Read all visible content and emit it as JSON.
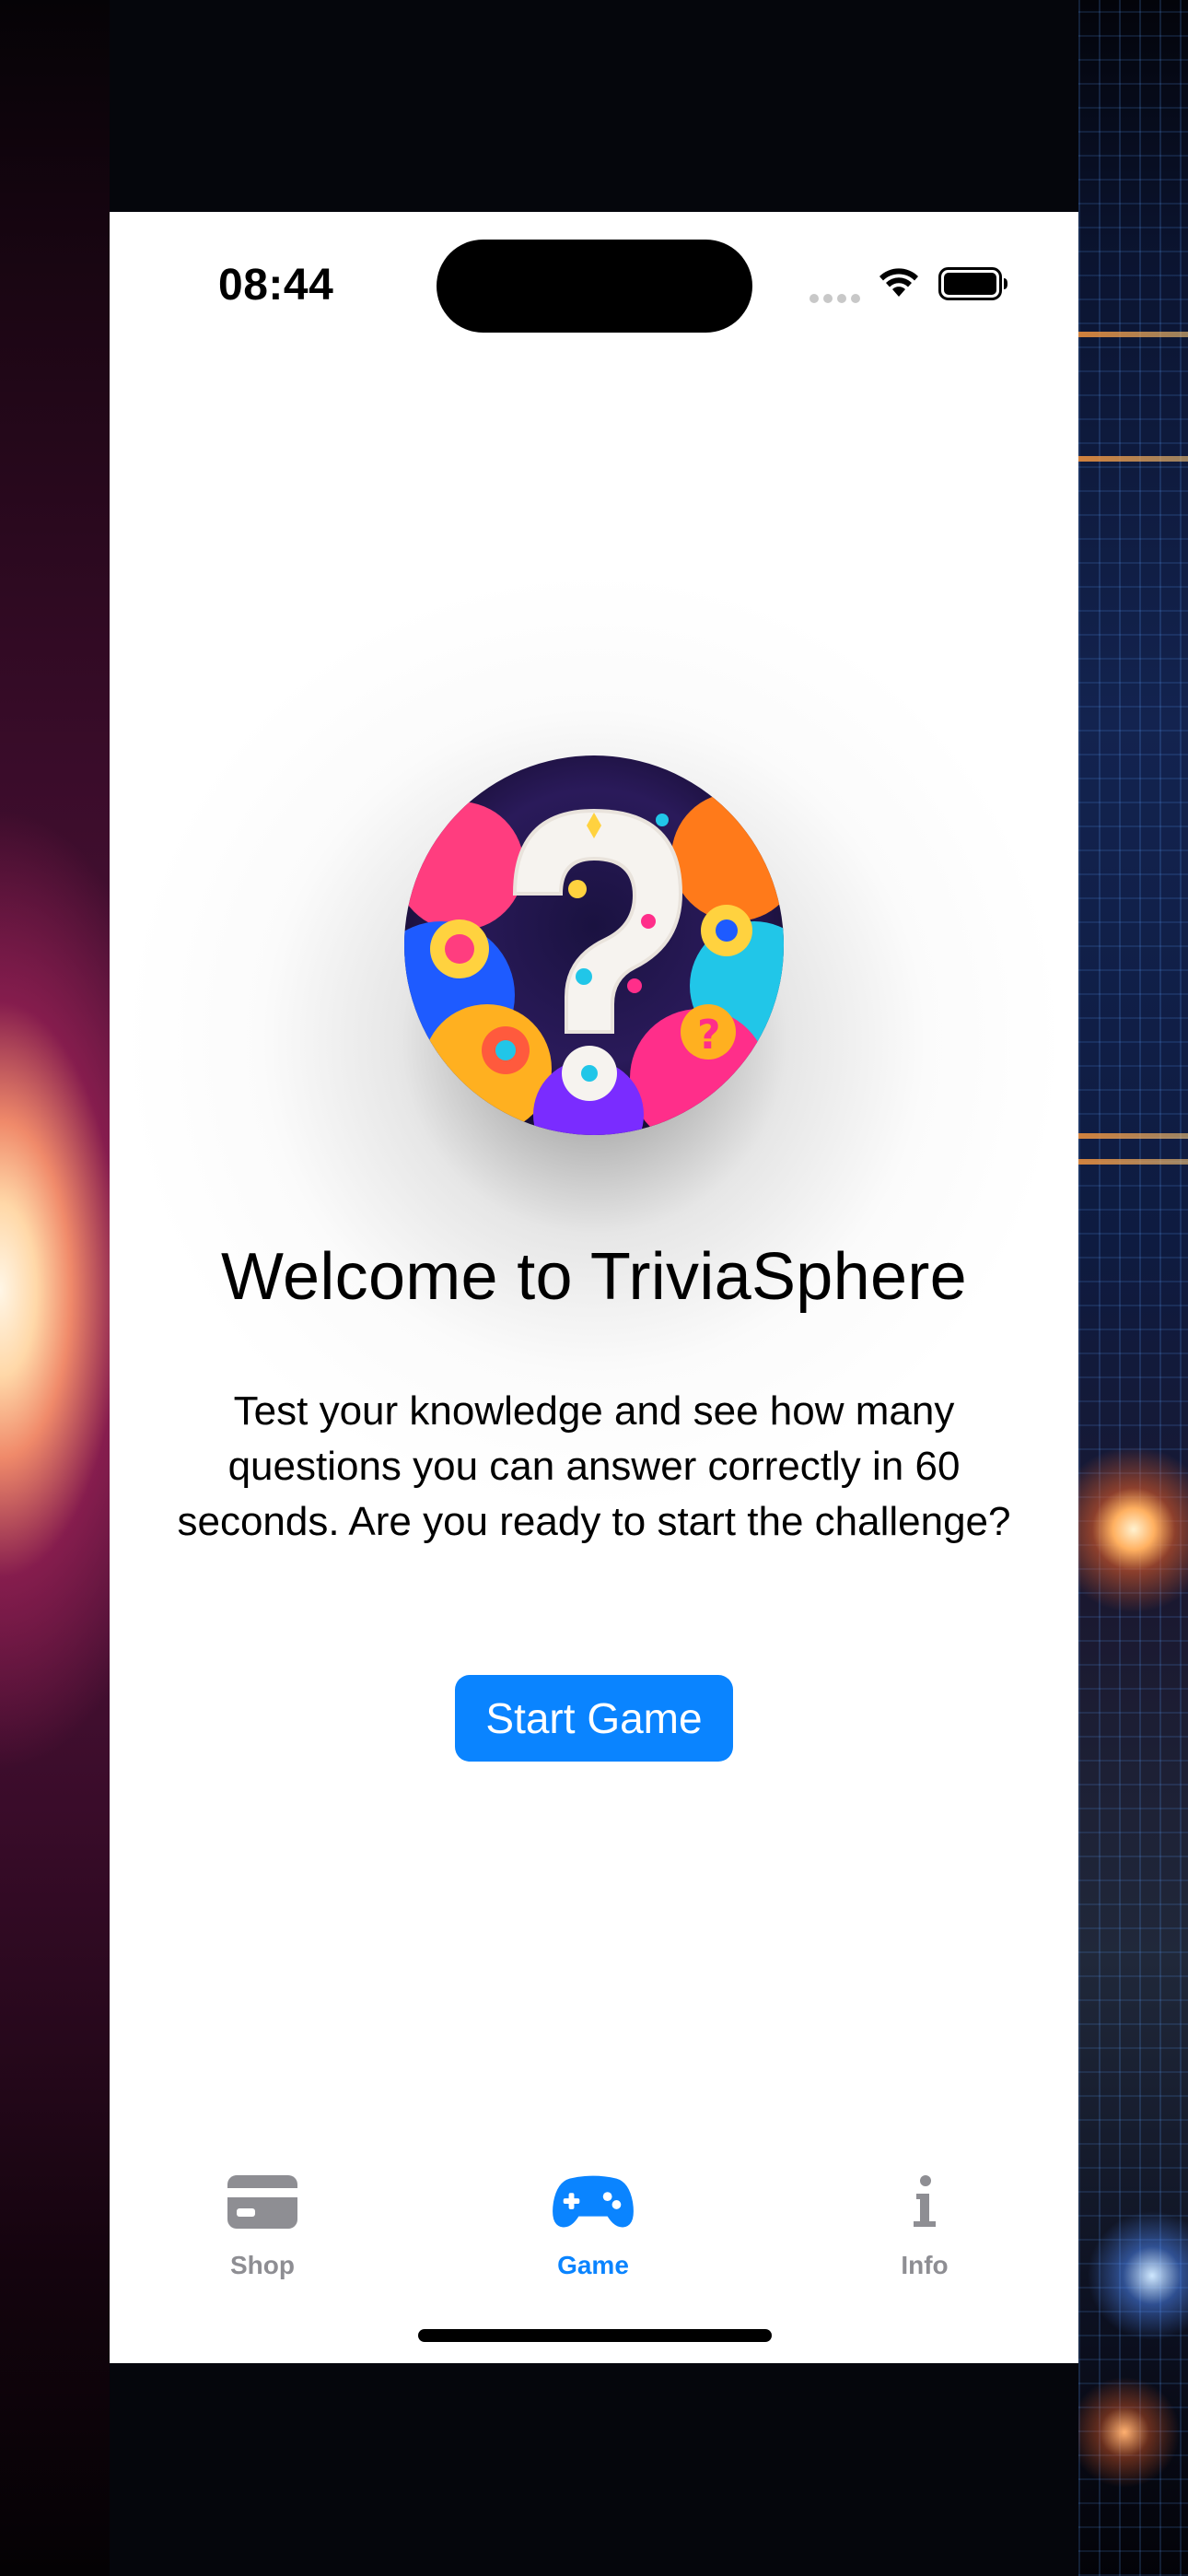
{
  "status_bar": {
    "time": "08:44"
  },
  "main": {
    "logo_icon": "colorful-question-mark-logo",
    "title": "Welcome to TriviaSphere",
    "description": "Test your knowledge and see how many questions you can answer correctly in 60 seconds. Are you ready to start the challenge?",
    "start_button_label": "Start Game"
  },
  "tab_bar": {
    "items": [
      {
        "label": "Shop",
        "icon": "credit-card-icon",
        "selected": false
      },
      {
        "label": "Game",
        "icon": "gamecontroller-icon",
        "selected": true
      },
      {
        "label": "Info",
        "icon": "info-icon",
        "selected": false
      }
    ]
  },
  "colors": {
    "accent": "#0a84ff",
    "inactive_tab": "#8e8e93",
    "background": "#ffffff"
  }
}
